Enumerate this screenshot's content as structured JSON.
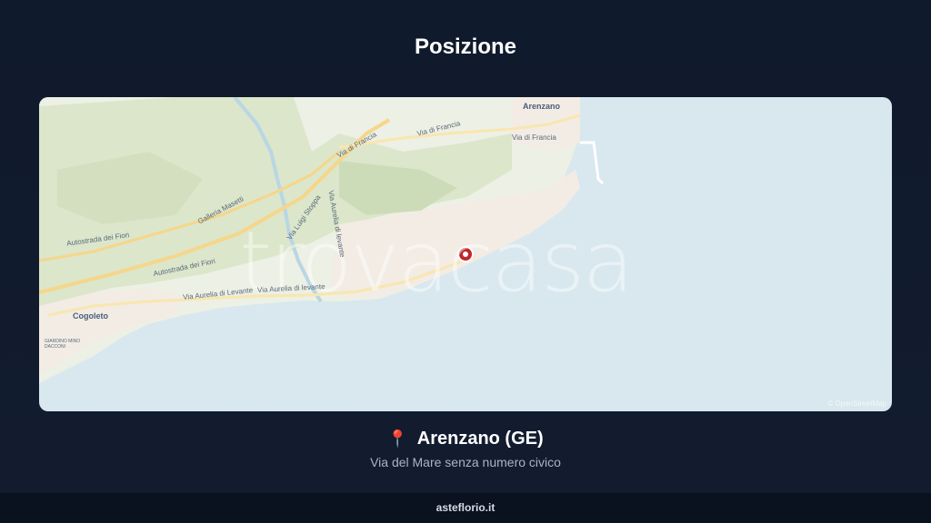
{
  "header": {
    "title": "Posizione"
  },
  "map": {
    "towns": {
      "arenzano": "Arenzano",
      "cogoleto": "Cogoleto"
    },
    "roads": {
      "via_di_francia_1": "Via di Francia",
      "via_di_francia_2": "Via di Francia",
      "via_di_francia_3": "Via di Francia",
      "galleria": "Galleria Masetti",
      "autostrada_1": "Autostrada dei Fiori",
      "autostrada_2": "Autostrada dei Fiori",
      "via_luigi": "Via Luigi Stoppa",
      "via_aurelia_1": "Via Aurelia di Levante",
      "via_aurelia_2": "Via Aurelia di levante",
      "via_aurelia_3": "Via Aurelia di levante"
    },
    "place_small": "GIARDINO MINO DACCONI",
    "watermark": "trovacasa",
    "attribution": "© OpenStreetMap",
    "marker_icon": "map-marker-icon"
  },
  "location": {
    "pin_icon": "📍",
    "city": "Arenzano (GE)",
    "address": "Via del Mare senza numero civico"
  },
  "footer": {
    "site": "asteflorio.it"
  },
  "colors": {
    "background": "#0f1a2c",
    "sea": "#d8e8ee",
    "marker": "#c0262d"
  }
}
